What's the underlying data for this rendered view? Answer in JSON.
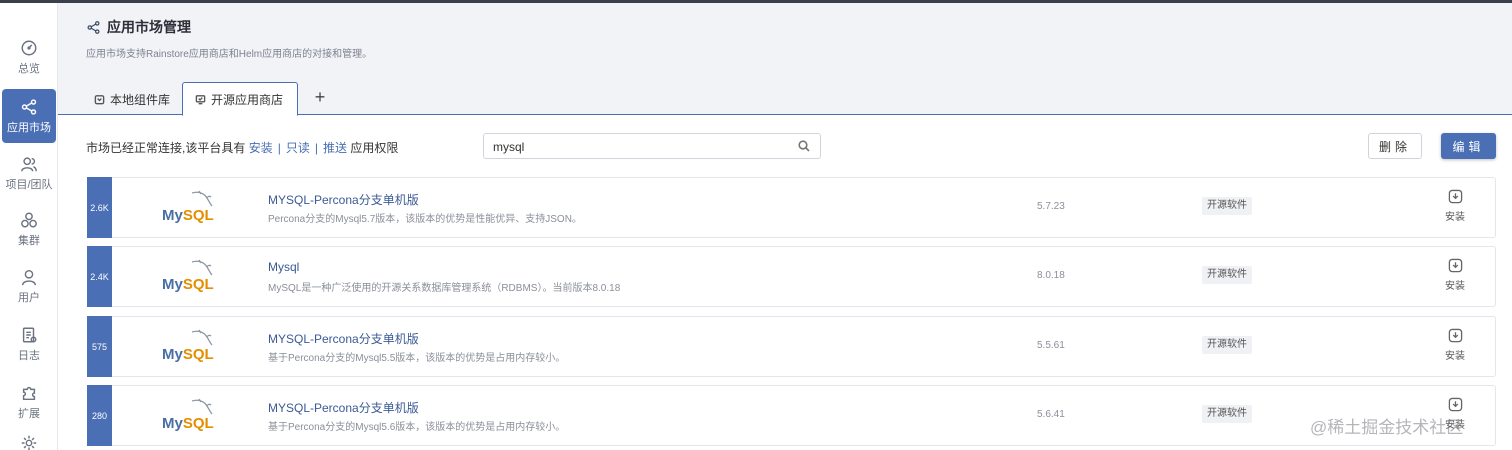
{
  "sidebar": {
    "items": [
      {
        "label": "总览",
        "icon": "dashboard-icon"
      },
      {
        "label": "应用市场",
        "icon": "share-icon",
        "active": true
      },
      {
        "label": "项目/团队",
        "icon": "team-icon"
      },
      {
        "label": "集群",
        "icon": "cluster-icon"
      },
      {
        "label": "用户",
        "icon": "user-icon"
      },
      {
        "label": "日志",
        "icon": "log-icon"
      },
      {
        "label": "扩展",
        "icon": "puzzle-icon"
      }
    ]
  },
  "header": {
    "title": "应用市场管理",
    "description": "应用市场支持Rainstore应用商店和Helm应用商店的对接和管理。",
    "tabs": [
      {
        "label": "本地组件库",
        "active": false
      },
      {
        "label": "开源应用商店",
        "active": true
      }
    ],
    "add_tab": "+"
  },
  "toolbar": {
    "permission_prefix": "市场已经正常连接,该平台具有",
    "permissions": [
      "安装",
      "只读",
      "推送"
    ],
    "separator": "|",
    "permission_suffix": "应用权限",
    "search_value": "mysql",
    "delete_label": "删除",
    "edit_label": "编辑"
  },
  "apps": [
    {
      "count": "2.6K",
      "logo_my": "My",
      "logo_sql": "SQL",
      "name": "MYSQL-Percona分支单机版",
      "desc": "Percona分支的Mysql5.7版本，该版本的优势是性能优异、支持JSON。",
      "version": "5.7.23",
      "tag": "开源软件",
      "action": "安装"
    },
    {
      "count": "2.4K",
      "logo_my": "My",
      "logo_sql": "SQL",
      "name": "Mysql",
      "desc": "MySQL是一种广泛使用的开源关系数据库管理系统（RDBMS）。当前版本8.0.18",
      "version": "8.0.18",
      "tag": "开源软件",
      "action": "安装"
    },
    {
      "count": "575",
      "logo_my": "My",
      "logo_sql": "SQL",
      "name": "MYSQL-Percona分支单机版",
      "desc": "基于Percona分支的Mysql5.5版本，该版本的优势是占用内存较小。",
      "version": "5.5.61",
      "tag": "开源软件",
      "action": "安装"
    },
    {
      "count": "280",
      "logo_my": "My",
      "logo_sql": "SQL",
      "name": "MYSQL-Percona分支单机版",
      "desc": "基于Percona分支的Mysql5.6版本，该版本的优势是占用内存较小。",
      "version": "5.6.41",
      "tag": "开源软件",
      "action": "安装"
    }
  ],
  "watermark": "@稀土掘金技术社区",
  "colors": {
    "accent": "#4a6fb5",
    "header_bg": "#f2f3f7",
    "logo_blue": "#4a6fa5",
    "logo_orange": "#e48e00"
  }
}
